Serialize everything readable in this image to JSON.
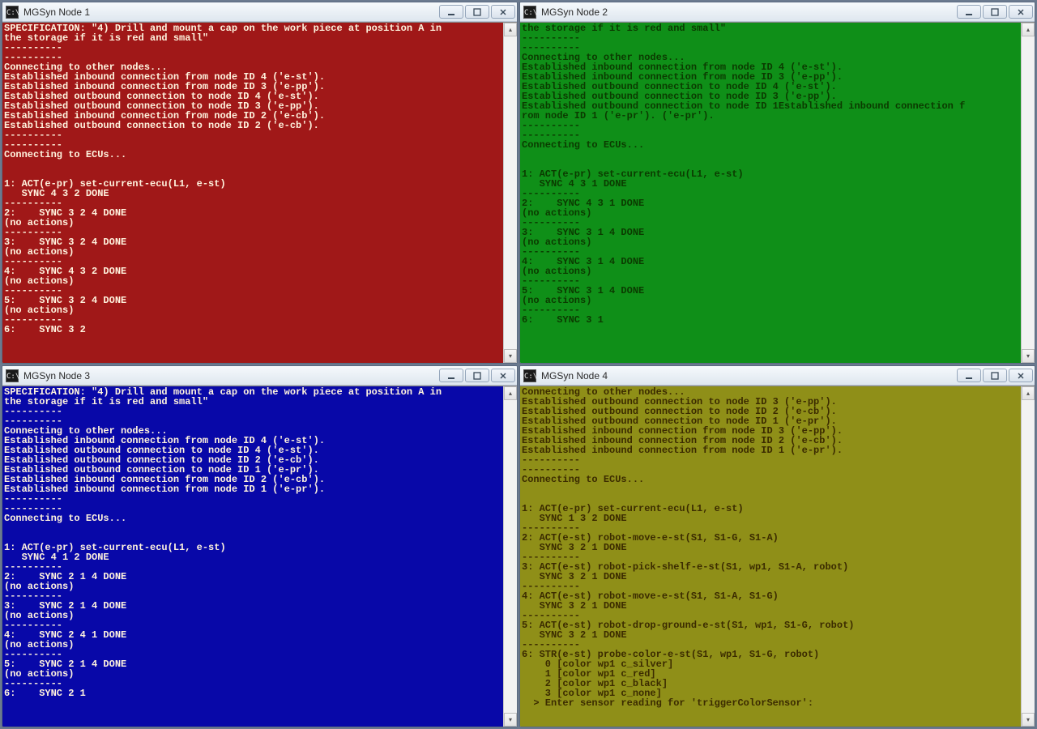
{
  "windows": [
    {
      "id": "node1",
      "title": "MGSyn Node 1",
      "lines": [
        "SPECIFICATION: \"4) Drill and mount a cap on the work piece at position A in",
        "the storage if it is red and small\"",
        "----------",
        "----------",
        "Connecting to other nodes...",
        "Established inbound connection from node ID 4 ('e-st').",
        "Established inbound connection from node ID 3 ('e-pp').",
        "Established outbound connection to node ID 4 ('e-st').",
        "Established outbound connection to node ID 3 ('e-pp').",
        "Established inbound connection from node ID 2 ('e-cb').",
        "Established outbound connection to node ID 2 ('e-cb').",
        "----------",
        "----------",
        "Connecting to ECUs...",
        "",
        "",
        "1: ACT(e-pr) set-current-ecu(L1, e-st)",
        "   SYNC 4 3 2 DONE",
        "----------",
        "2:    SYNC 3 2 4 DONE",
        "(no actions)",
        "----------",
        "3:    SYNC 3 2 4 DONE",
        "(no actions)",
        "----------",
        "4:    SYNC 4 3 2 DONE",
        "(no actions)",
        "----------",
        "5:    SYNC 3 2 4 DONE",
        "(no actions)",
        "----------",
        "6:    SYNC 3 2"
      ]
    },
    {
      "id": "node2",
      "title": "MGSyn Node 2",
      "lines": [
        "the storage if it is red and small\"",
        "----------",
        "----------",
        "Connecting to other nodes...",
        "Established inbound connection from node ID 4 ('e-st').",
        "Established inbound connection from node ID 3 ('e-pp').",
        "Established outbound connection to node ID 4 ('e-st').",
        "Established outbound connection to node ID 3 ('e-pp').",
        "Established outbound connection to node ID 1Established inbound connection f",
        "rom node ID 1 ('e-pr'). ('e-pr').",
        "----------",
        "----------",
        "Connecting to ECUs...",
        "",
        "",
        "1: ACT(e-pr) set-current-ecu(L1, e-st)",
        "   SYNC 4 3 1 DONE",
        "----------",
        "2:    SYNC 4 3 1 DONE",
        "(no actions)",
        "----------",
        "3:    SYNC 3 1 4 DONE",
        "(no actions)",
        "----------",
        "4:    SYNC 3 1 4 DONE",
        "(no actions)",
        "----------",
        "5:    SYNC 3 1 4 DONE",
        "(no actions)",
        "----------",
        "6:    SYNC 3 1"
      ]
    },
    {
      "id": "node3",
      "title": "MGSyn Node 3",
      "lines": [
        "SPECIFICATION: \"4) Drill and mount a cap on the work piece at position A in",
        "the storage if it is red and small\"",
        "----------",
        "----------",
        "Connecting to other nodes...",
        "Established inbound connection from node ID 4 ('e-st').",
        "Established outbound connection to node ID 4 ('e-st').",
        "Established outbound connection to node ID 2 ('e-cb').",
        "Established outbound connection to node ID 1 ('e-pr').",
        "Established inbound connection from node ID 2 ('e-cb').",
        "Established inbound connection from node ID 1 ('e-pr').",
        "----------",
        "----------",
        "Connecting to ECUs...",
        "",
        "",
        "1: ACT(e-pr) set-current-ecu(L1, e-st)",
        "   SYNC 4 1 2 DONE",
        "----------",
        "2:    SYNC 2 1 4 DONE",
        "(no actions)",
        "----------",
        "3:    SYNC 2 1 4 DONE",
        "(no actions)",
        "----------",
        "4:    SYNC 2 4 1 DONE",
        "(no actions)",
        "----------",
        "5:    SYNC 2 1 4 DONE",
        "(no actions)",
        "----------",
        "6:    SYNC 2 1"
      ]
    },
    {
      "id": "node4",
      "title": "MGSyn Node 4",
      "lines": [
        "Connecting to other nodes...",
        "Established outbound connection to node ID 3 ('e-pp').",
        "Established outbound connection to node ID 2 ('e-cb').",
        "Established outbound connection to node ID 1 ('e-pr').",
        "Established inbound connection from node ID 3 ('e-pp').",
        "Established inbound connection from node ID 2 ('e-cb').",
        "Established inbound connection from node ID 1 ('e-pr').",
        "----------",
        "----------",
        "Connecting to ECUs...",
        "",
        "",
        "1: ACT(e-pr) set-current-ecu(L1, e-st)",
        "   SYNC 1 3 2 DONE",
        "----------",
        "2: ACT(e-st) robot-move-e-st(S1, S1-G, S1-A)",
        "   SYNC 3 2 1 DONE",
        "----------",
        "3: ACT(e-st) robot-pick-shelf-e-st(S1, wp1, S1-A, robot)",
        "   SYNC 3 2 1 DONE",
        "----------",
        "4: ACT(e-st) robot-move-e-st(S1, S1-A, S1-G)",
        "   SYNC 3 2 1 DONE",
        "----------",
        "5: ACT(e-st) robot-drop-ground-e-st(S1, wp1, S1-G, robot)",
        "   SYNC 3 2 1 DONE",
        "----------",
        "6: STR(e-st) probe-color-e-st(S1, wp1, S1-G, robot)",
        "    0 [color wp1 c_silver]",
        "    1 [color wp1 c_red]",
        "    2 [color wp1 c_black]",
        "    3 [color wp1 c_none]",
        "  > Enter sensor reading for 'triggerColorSensor':"
      ]
    }
  ],
  "app_icon_text": "C:\\"
}
